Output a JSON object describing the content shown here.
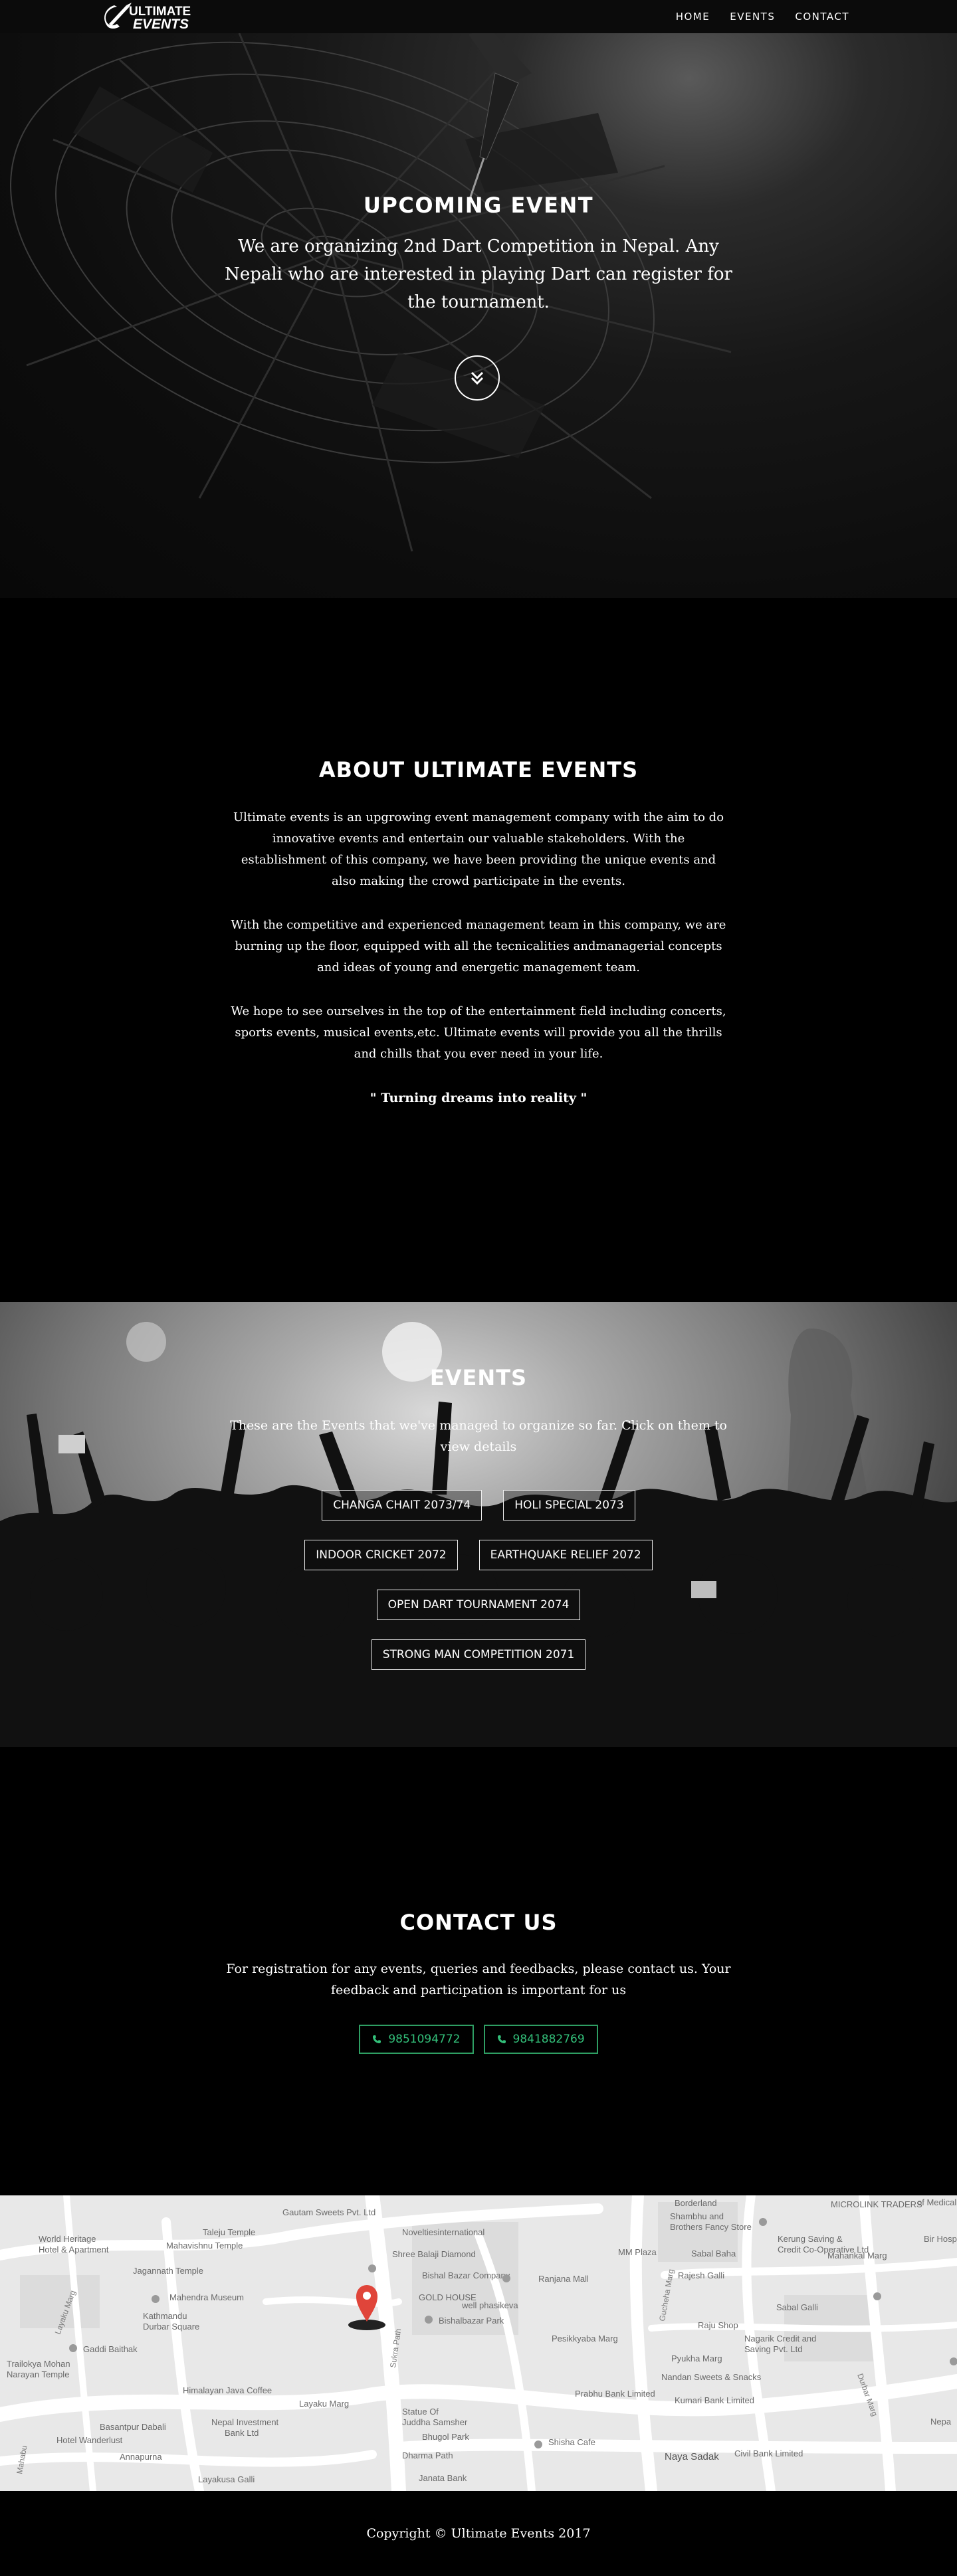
{
  "nav": {
    "logo_line1": "ULTIMATE",
    "logo_line2": "EVENTS",
    "links": [
      "HOME",
      "EVENTS",
      "CONTACT"
    ]
  },
  "hero": {
    "title": "UPCOMING EVENT",
    "text": "We are organizing 2nd Dart Competition in Nepal. Any Nepali who are interested in playing Dart can register for the tournament.",
    "scroll_icon": "chevron-double-down-icon"
  },
  "about": {
    "title": "ABOUT ULTIMATE EVENTS",
    "paragraphs": [
      "Ultimate events is an upgrowing event management company with the aim to do innovative events and entertain our valuable stakeholders. With the establishment of this company, we have been providing the unique events and also making the crowd participate in the events.",
      "With the competitive and experienced management team in this company, we are burning up the floor, equipped with all the tecnicalities andmanagerial concepts and ideas of young and energetic management team.",
      "We hope to see ourselves in the top of the entertainment field including concerts, sports events, musical events,etc. Ultimate events will provide you all the thrills and chills that you ever need in your life."
    ],
    "tagline": "\" Turning dreams into reality \""
  },
  "events": {
    "title": "EVENTS",
    "subtitle": "These are the Events that we've managed to organize so far. Click on them to view details",
    "items": [
      "CHANGA CHAIT 2073/74",
      "HOLI SPECIAL 2073",
      "INDOOR CRICKET 2072",
      "EARTHQUAKE RELIEF 2072",
      "OPEN DART TOURNAMENT 2074",
      "STRONG MAN COMPETITION 2071"
    ]
  },
  "contact": {
    "title": "CONTACT US",
    "subtitle": "For registration for any events, queries and feedbacks, please contact us. Your feedback and participation is important for us",
    "phones": [
      "9851094772",
      "9841882769"
    ],
    "accent": "#33c07a"
  },
  "map": {
    "labels": [
      "World Heritage Hotel & Apartment",
      "Taleju Temple",
      "Mahavishnu Temple",
      "Jagannath Temple",
      "Mahendra Museum",
      "Kathmandu Durbar Square",
      "Gaddi Baithak",
      "Trailokya Mohan Narayan Temple",
      "Himalayan Java Coffee",
      "Basantpur Dabali",
      "Hotel Wanderlust",
      "Annapurna",
      "Layaku Marg",
      "Layakusa Galli",
      "Nepal Investment Bank Ltd",
      "Gautam Sweets Pvt. Ltd",
      "Noveltiesinternational",
      "Shree Balaji Diamond",
      "Bishal Bazar Company",
      "GOLD HOUSE",
      "Bishalbazar Park",
      "well phasikeva",
      "Ranjana Mall",
      "Statue Of Juddha Samsher",
      "Bhugol Park",
      "Shisha Cafe",
      "Dharma Path",
      "Janata Bank",
      "Prabhu Bank Limited",
      "Kumari Bank Limited",
      "Nandan Sweets & Snacks",
      "Naya Sadak",
      "Civil Bank Limited",
      "Shambhu and Brothers Fancy Store",
      "MM Plaza",
      "Kerung Saving & Credit Co-Operative Ltd",
      "Sabal Baha",
      "Mahankal Marg",
      "Rajesh Galli",
      "Raju Shop",
      "Nagarik Credit and Saving Pvt. Ltd",
      "Pyukha Marg",
      "Sabal Galli",
      "Bir Hospital",
      "MICROLINK TRADERS",
      "Borderland",
      "Khichapokhari Marg",
      "Sukra Path",
      "Gucheha Marg",
      "Pesikkyaba Marg",
      "Durbar Marg",
      "Mahabu"
    ]
  },
  "footer": {
    "copyright": "Copyright © Ultimate Events 2017"
  }
}
